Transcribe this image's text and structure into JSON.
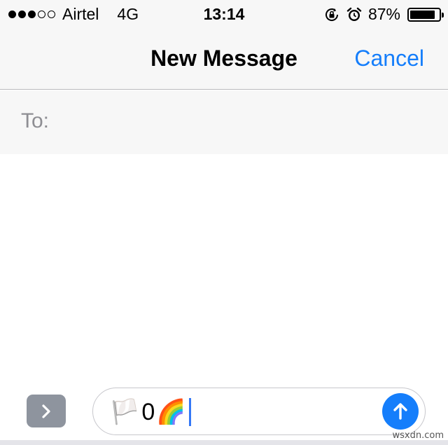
{
  "status_bar": {
    "signal_dots_filled": 3,
    "signal_dots_total": 5,
    "carrier": "Airtel",
    "network": "4G",
    "time": "13:14",
    "battery_percent": "87%",
    "battery_level": 0.87,
    "icons": [
      "rotation-lock-icon",
      "alarm-icon",
      "battery-icon"
    ]
  },
  "nav": {
    "title": "New Message",
    "cancel_label": "Cancel"
  },
  "recipient": {
    "label": "To:",
    "value": ""
  },
  "composer": {
    "message_emoji_start": "🏳️",
    "message_text": "0",
    "message_emoji_end": "🌈",
    "expand_icon": "chevron-right-icon",
    "send_icon": "arrow-up-icon"
  },
  "watermark": "wsxdn.com",
  "colors": {
    "accent": "#157efb",
    "bar_background": "#f7f7f7",
    "expand_button": "#8e949e",
    "caret": "#3478f6"
  }
}
